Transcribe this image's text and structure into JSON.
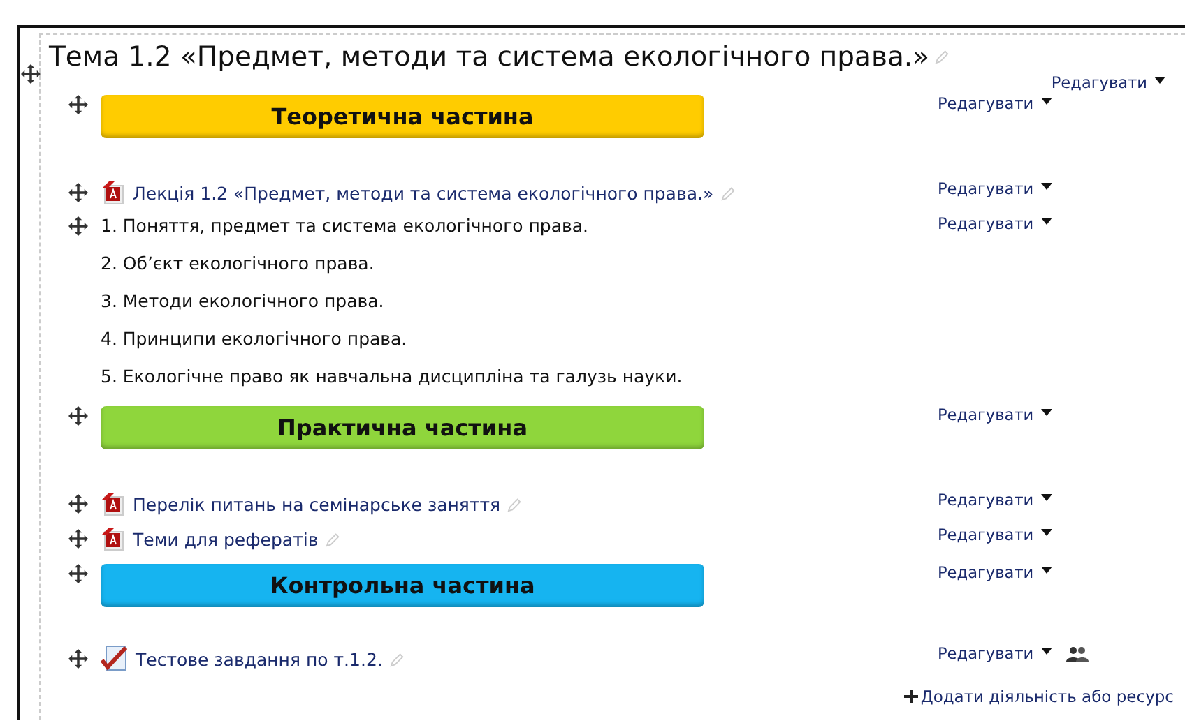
{
  "section": {
    "title": "Тема 1.2 «Предмет, методи та система екологічного права.»",
    "edit": "Редагувати"
  },
  "items": [
    {
      "kind": "banner",
      "label": "Теоретична частина",
      "color": "#ffcc00",
      "edit": "Редагувати"
    },
    {
      "kind": "file",
      "label": "Лекція 1.2 «Предмет, методи та система екологічного права.»",
      "edit": "Редагувати"
    },
    {
      "kind": "text",
      "label": "1. Поняття, предмет та система екологічного права.",
      "movable": true,
      "edit": "Редагувати"
    },
    {
      "kind": "text",
      "label": "2. Об’єкт екологічного права.",
      "movable": false
    },
    {
      "kind": "text",
      "label": "3. Методи екологічного права.",
      "movable": false
    },
    {
      "kind": "text",
      "label": "4. Принципи екологічного права.",
      "movable": false
    },
    {
      "kind": "text",
      "label": "5. Екологічне право як навчальна дисципліна та галузь науки.",
      "movable": false
    },
    {
      "kind": "banner",
      "label": "Практична частина",
      "color": "#8fd63c",
      "edit": "Редагувати"
    },
    {
      "kind": "file",
      "label": "Перелік питань на семінарське заняття",
      "edit": "Редагувати"
    },
    {
      "kind": "file",
      "label": "Теми для рефератів",
      "edit": "Редагувати"
    },
    {
      "kind": "banner",
      "label": "Контрольна частина",
      "color": "#16b4f0",
      "edit": "Редагувати"
    },
    {
      "kind": "quiz",
      "label": "Тестове завдання по т.1.2.",
      "edit": "Редагувати",
      "group_mode": true
    }
  ],
  "add_link": "Додати діяльність або ресурс"
}
